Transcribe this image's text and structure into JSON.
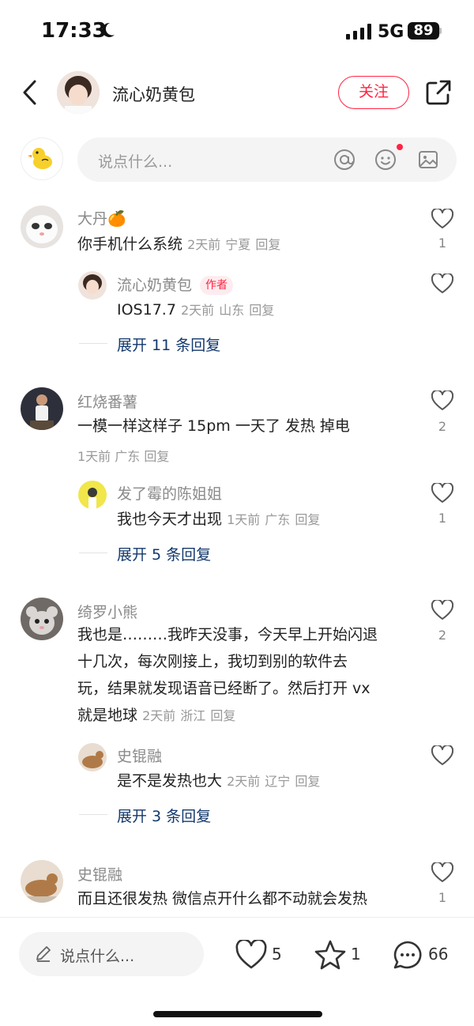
{
  "status_bar": {
    "time": "17:33",
    "network": "5G",
    "battery": "89"
  },
  "header": {
    "author_name": "流心奶黄包",
    "follow_label": "关注"
  },
  "comment_bar": {
    "placeholder": "说点什么..."
  },
  "comments": [
    {
      "user": "大丹🍊",
      "text": "你手机什么系统",
      "time": "2天前",
      "location": "宁夏",
      "reply_label": "回复",
      "likes": "1",
      "replies": [
        {
          "user": "流心奶黄包",
          "tag": "作者",
          "text": "IOS17.7",
          "time": "2天前",
          "location": "山东",
          "reply_label": "回复"
        }
      ],
      "expand_label": "展开 11 条回复"
    },
    {
      "user": "红烧番薯",
      "text": "一模一样这样子 15pm 一天了 发热 掉电",
      "time": "1天前",
      "location": "广东",
      "reply_label": "回复",
      "likes": "2",
      "replies": [
        {
          "user": "发了霉的陈姐姐",
          "text": "我也今天才出现",
          "time": "1天前",
          "location": "广东",
          "reply_label": "回复",
          "likes": "1"
        }
      ],
      "expand_label": "展开 5 条回复"
    },
    {
      "user": "绮罗小熊",
      "text_lines": [
        "我也是………我昨天没事，今天早上开始闪退",
        "十几次，每次刚接上，我切到别的软件去",
        "玩，结果就发现语音已经断了。然后打开 vx",
        "就是地球"
      ],
      "time": "2天前",
      "location": "浙江",
      "reply_label": "回复",
      "likes": "2",
      "replies": [
        {
          "user": "史锟融",
          "text": "是不是发热也大",
          "time": "2天前",
          "location": "辽宁",
          "reply_label": "回复"
        }
      ],
      "expand_label": "展开 3 条回复"
    },
    {
      "user": "史锟融",
      "text": "而且还很发热 微信点开什么都不动就会发热",
      "likes": "1"
    }
  ],
  "bottom_bar": {
    "placeholder": "说点什么...",
    "likes": "5",
    "favorites": "1",
    "comments": "66"
  },
  "colors": {
    "accent": "#ff2442",
    "link": "#13386c"
  }
}
